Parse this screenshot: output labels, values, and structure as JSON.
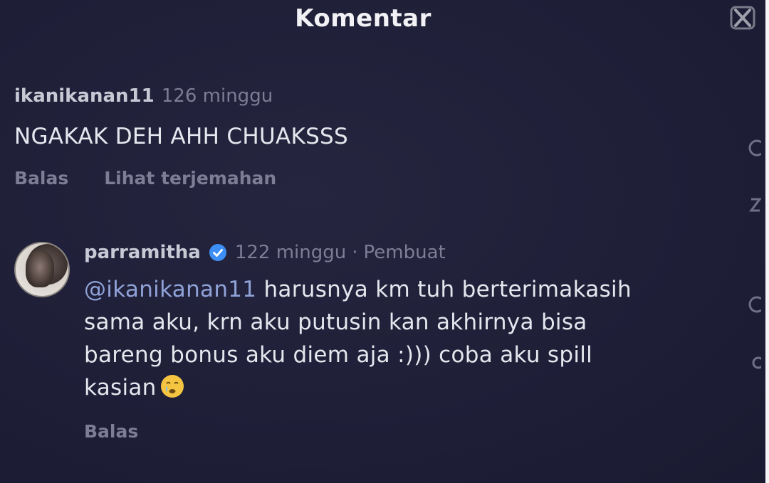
{
  "header": {
    "title": "Komentar"
  },
  "comments": [
    {
      "username": "ikanikanan11",
      "time": "126 minggu",
      "text": "NGAKAK DEH AHH CHUAKSSS",
      "actions": {
        "reply": "Balas",
        "translate": "Lihat terjemahan"
      }
    },
    {
      "username": "parramitha",
      "verified": true,
      "time": "122 minggu",
      "separator": "·",
      "badge": "Pembuat",
      "mention": "@ikanikanan11",
      "text": " harusnya km tuh berterimakasih sama aku, krn aku putusin kan akhirnya bisa bareng bonus aku diem aja :))) coba aku spill kasian",
      "emoji": "crying-face-emoji",
      "actions": {
        "reply": "Balas"
      }
    }
  ],
  "colors": {
    "background": "#1f1f38",
    "muted_text": "#7d7d95",
    "mention": "#8fa3d8",
    "verified_badge": "#3d8ff5"
  }
}
